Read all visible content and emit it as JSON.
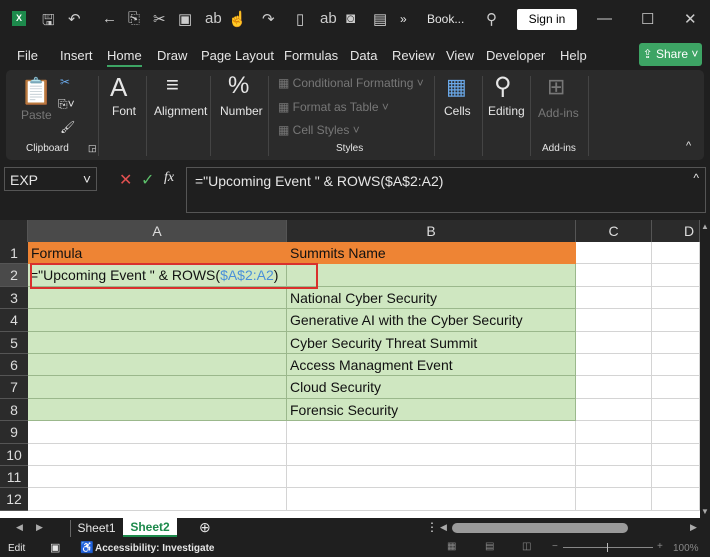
{
  "title_bar": {
    "filename": "Book...",
    "sign_in": "Sign in",
    "overflow": "»"
  },
  "menu": {
    "items": [
      "File",
      "Insert",
      "Home",
      "Draw",
      "Page Layout",
      "Formulas",
      "Data",
      "Review",
      "View",
      "Developer",
      "Help"
    ],
    "active": "Home",
    "share": "Share"
  },
  "ribbon": {
    "paste": "Paste",
    "clipboard": "Clipboard",
    "font": "Font",
    "alignment": "Alignment",
    "number": "Number",
    "conditional_formatting": "Conditional Formatting",
    "format_as_table": "Format as Table",
    "cell_styles": "Cell Styles",
    "styles": "Styles",
    "cells": "Cells",
    "editing": "Editing",
    "addins_button": "Add-ins",
    "addins_group": "Add-ins"
  },
  "formula_bar": {
    "name_box": "EXP",
    "fx": "fx",
    "formula": "=\"Upcoming Event \" & ROWS($A$2:A2)"
  },
  "sheet": {
    "columns": [
      "A",
      "B",
      "C",
      "D"
    ],
    "rows": [
      "1",
      "2",
      "3",
      "4",
      "5",
      "6",
      "7",
      "8",
      "9",
      "10",
      "11",
      "12"
    ],
    "a1": "Formula",
    "b1": "Summits Name",
    "a2_text": "=\"Upcoming Event \" & ROWS(",
    "a2_ref": "$A$2:A2",
    "a2_close": ")",
    "b_values": [
      "",
      "National Cyber Security",
      "Generative AI with the Cyber Security",
      "Cyber Security  Threat Summit",
      "Access Managment Event",
      "Cloud Security",
      "Forensic Security"
    ],
    "header_color": "#ee8434",
    "fill_color": "#cfe7c1",
    "ref_color": "#4a90d9",
    "highlight_color": "#d9302c"
  },
  "tabs": {
    "sheets": [
      "Sheet1",
      "Sheet2"
    ],
    "active": "Sheet2"
  },
  "status": {
    "mode": "Edit",
    "accessibility": "Accessibility: Investigate",
    "zoom": "100%"
  }
}
